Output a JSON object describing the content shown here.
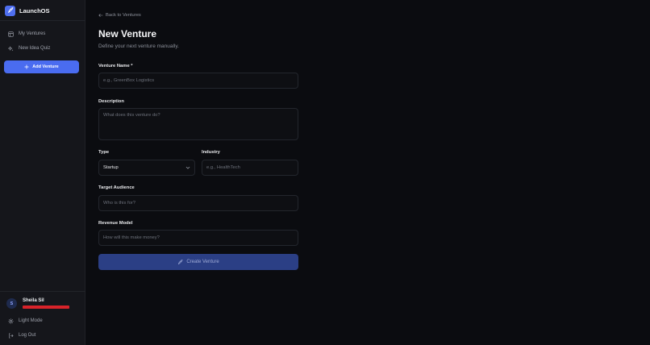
{
  "app": {
    "name": "LaunchOS"
  },
  "sidebar": {
    "items": [
      {
        "label": "My Ventures",
        "icon": "grid-icon"
      },
      {
        "label": "New Idea Quiz",
        "icon": "sparkles-icon"
      }
    ],
    "add_button": {
      "label": "Add Venture",
      "icon": "plus-icon"
    }
  },
  "user": {
    "initial": "S",
    "name": "Sheila Sil"
  },
  "footer": {
    "theme_label": "Light Mode",
    "logout_label": "Log Out"
  },
  "page": {
    "back_label": "Back to Ventures",
    "title": "New Venture",
    "subtitle": "Define your next venture manually."
  },
  "form": {
    "name": {
      "label": "Venture Name *",
      "placeholder": "e.g., GreenBox Logistics"
    },
    "description": {
      "label": "Description",
      "placeholder": "What does this venture do?"
    },
    "type": {
      "label": "Type",
      "value": "Startup"
    },
    "industry": {
      "label": "Industry",
      "placeholder": "e.g., HealthTech"
    },
    "audience": {
      "label": "Target Audience",
      "placeholder": "Who is this for?"
    },
    "revenue": {
      "label": "Revenue Model",
      "placeholder": "How will this make money?"
    },
    "submit_label": "Create Venture"
  },
  "colors": {
    "accent": "#4a6cf0",
    "submit_bg": "#2b3f85",
    "redaction": "#d8232a"
  }
}
